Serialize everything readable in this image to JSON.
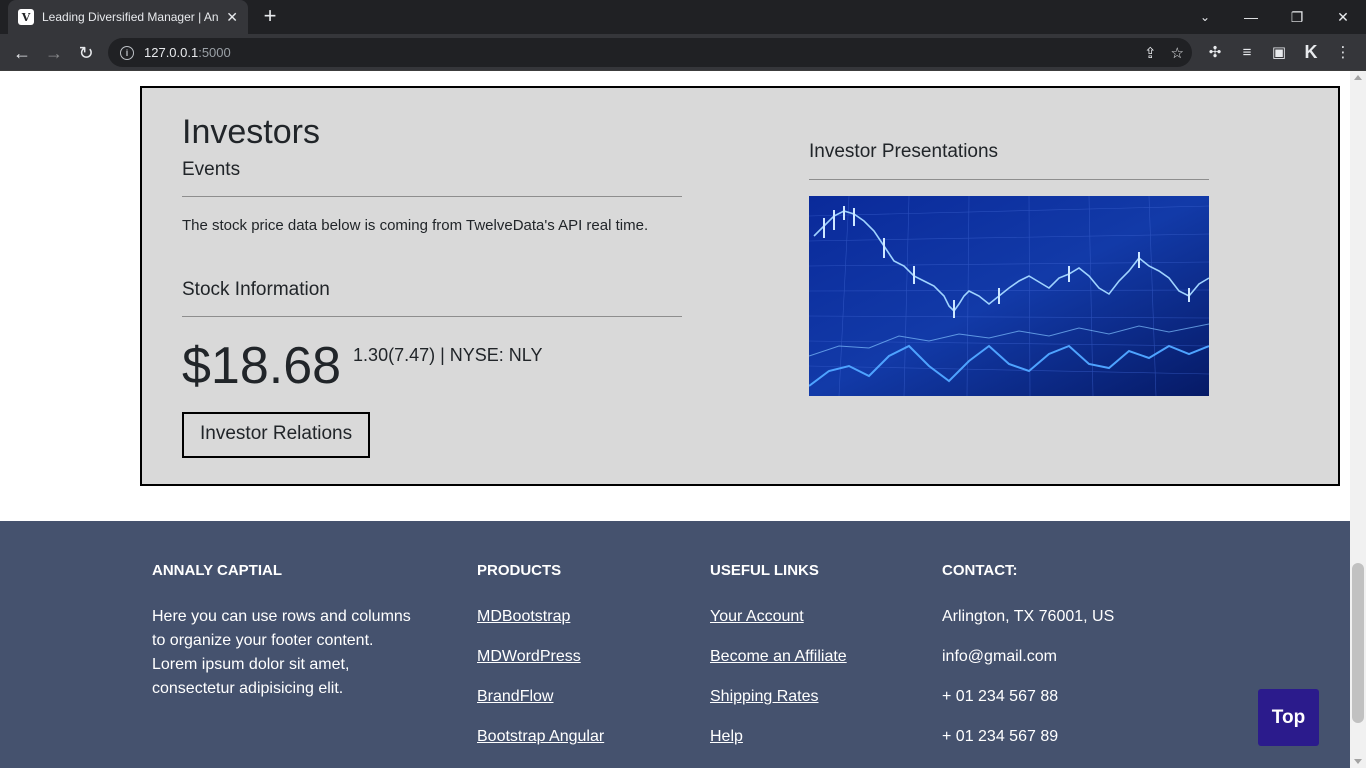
{
  "browser": {
    "tab_title": "Leading Diversified Manager | An",
    "url_host": "127.0.0.1",
    "url_port": ":5000"
  },
  "investors": {
    "title": "Investors",
    "events_label": "Events",
    "description": "The stock price data below is coming from TwelveData's API real time.",
    "stock_info_label": "Stock Information",
    "price": "$18.68",
    "change": "1.30(7.47) | NYSE: NLY",
    "relations_button": "Investor Relations",
    "presentations_label": "Investor Presentations"
  },
  "footer": {
    "brand": {
      "heading": "ANNALY CAPTIAL",
      "text": "Here you can use rows and columns to organize your footer content. Lorem ipsum dolor sit amet, consectetur adipisicing elit."
    },
    "products": {
      "heading": "PRODUCTS",
      "links": [
        "MDBootstrap",
        "MDWordPress",
        "BrandFlow",
        "Bootstrap Angular"
      ]
    },
    "useful_links": {
      "heading": "USEFUL LINKS",
      "links": [
        "Your Account",
        "Become an Affiliate",
        "Shipping Rates",
        "Help"
      ]
    },
    "contact": {
      "heading": "CONTACT:",
      "items": [
        "Arlington, TX 76001, US",
        "info@gmail.com",
        "+ 01 234 567 88",
        "+ 01 234 567 89"
      ]
    }
  },
  "top_button": "Top"
}
